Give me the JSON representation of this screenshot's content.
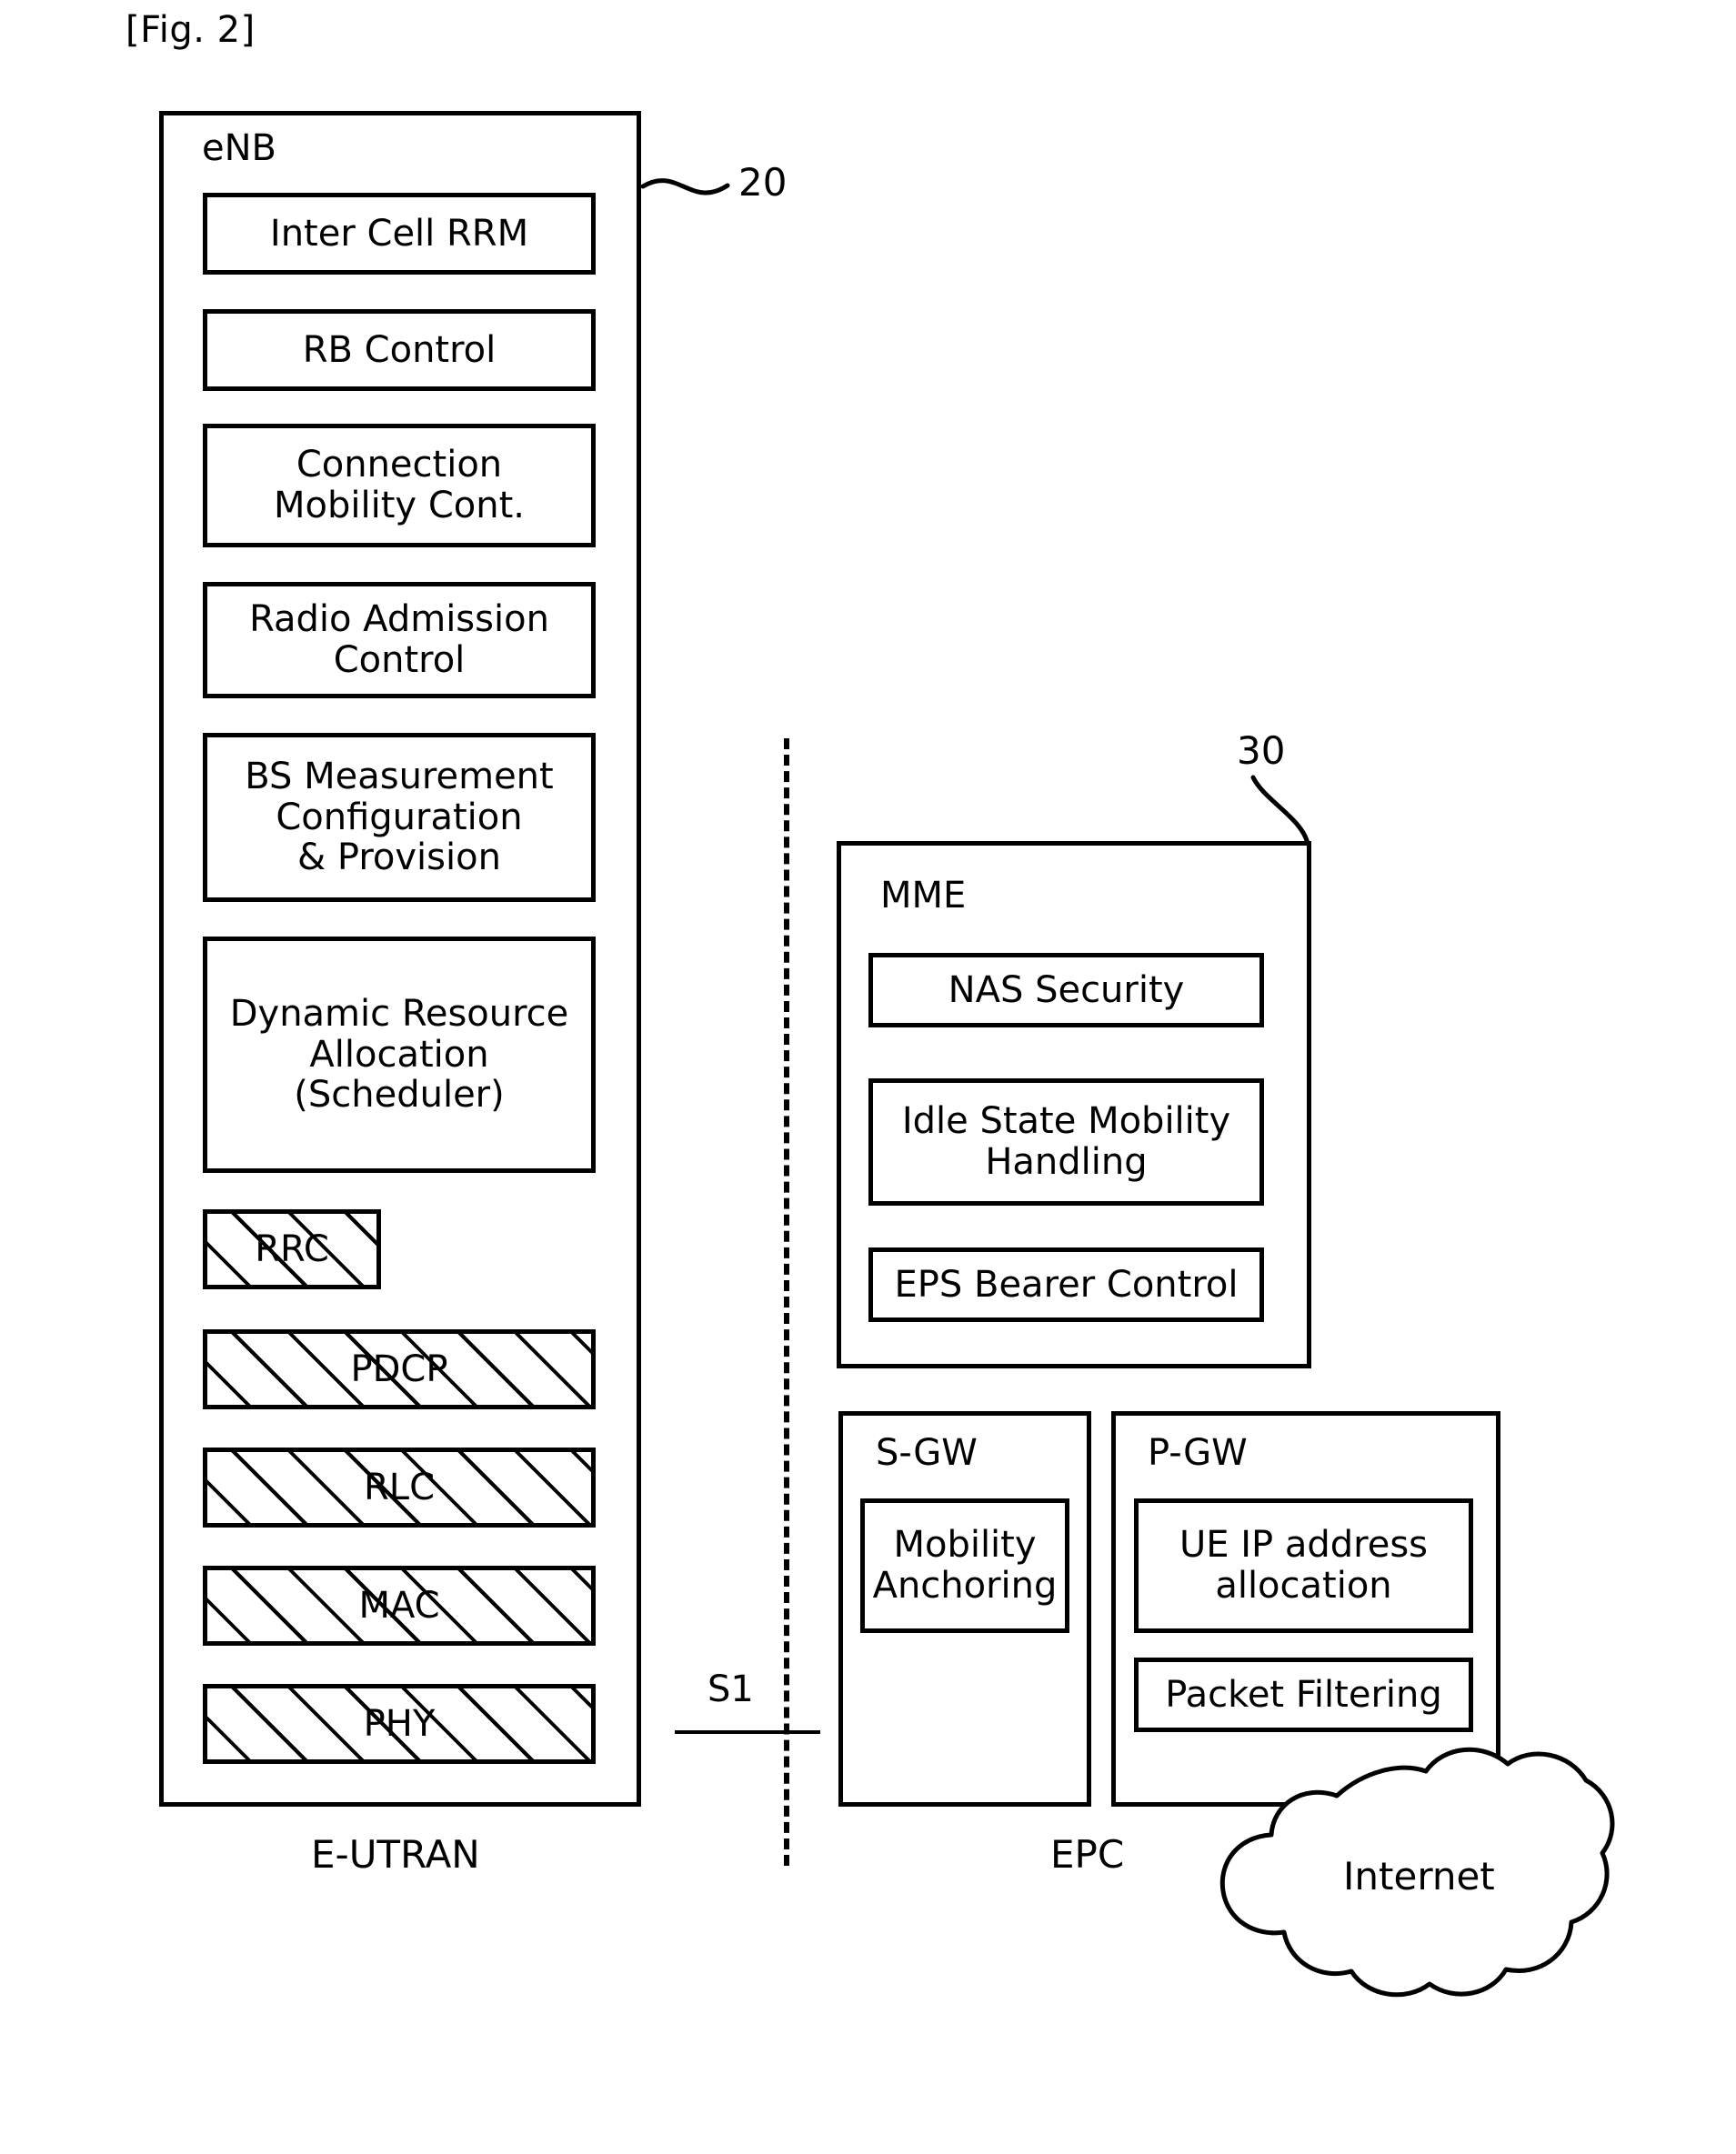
{
  "figure": {
    "caption": "[Fig. 2]"
  },
  "enb": {
    "title": "eNB",
    "ref": "20",
    "zone_label": "E-UTRAN",
    "functions": [
      {
        "label": "Inter Cell RRM"
      },
      {
        "label": "RB Control"
      },
      {
        "label": "Connection\nMobility Cont."
      },
      {
        "label": "Radio Admission\nControl"
      },
      {
        "label": "BS Measurement\nConfiguration\n& Provision"
      },
      {
        "label": "Dynamic Resource\nAllocation\n(Scheduler)"
      }
    ],
    "protocol_stack": [
      {
        "label": "RRC"
      },
      {
        "label": "PDCP"
      },
      {
        "label": "RLC"
      },
      {
        "label": "MAC"
      },
      {
        "label": "PHY"
      }
    ]
  },
  "interface": {
    "label": "S1"
  },
  "epc": {
    "ref": "30",
    "zone_label": "EPC",
    "mme": {
      "title": "MME",
      "functions": [
        {
          "label": "NAS Security"
        },
        {
          "label": "Idle State Mobility\nHandling"
        },
        {
          "label": "EPS Bearer Control"
        }
      ]
    },
    "sgw": {
      "title": "S-GW",
      "functions": [
        {
          "label": "Mobility\nAnchoring"
        }
      ]
    },
    "pgw": {
      "title": "P-GW",
      "functions": [
        {
          "label": "UE IP address\nallocation"
        },
        {
          "label": "Packet Filtering"
        }
      ]
    }
  },
  "internet": {
    "label": "Internet"
  },
  "colors": {
    "line": "#000000",
    "background": "#ffffff"
  }
}
